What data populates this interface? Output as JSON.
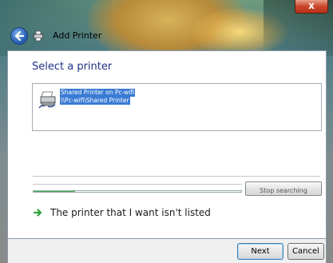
{
  "window": {
    "title": "Add Printer",
    "close_label": "x"
  },
  "main": {
    "heading": "Select a printer",
    "printer_list": [
      {
        "name": "Shared Printer on Pc-wifi",
        "path": "\\\\Pc-wifi\\Shared Printer",
        "selected": true
      }
    ],
    "search_progress": 0.2,
    "stop_button_label": "Stop searching",
    "not_listed_link": "The printer that I want isn't listed"
  },
  "footer": {
    "next_label": "Next",
    "cancel_label": "Cancel"
  },
  "colors": {
    "heading": "#1e3287",
    "selection": "#3a7bd5",
    "progress": "#2f9c44",
    "link_arrow": "#2fa33e"
  },
  "icons": [
    "back-arrow-icon",
    "printer-icon",
    "shared-printer-icon",
    "green-arrow-icon",
    "close-icon"
  ]
}
